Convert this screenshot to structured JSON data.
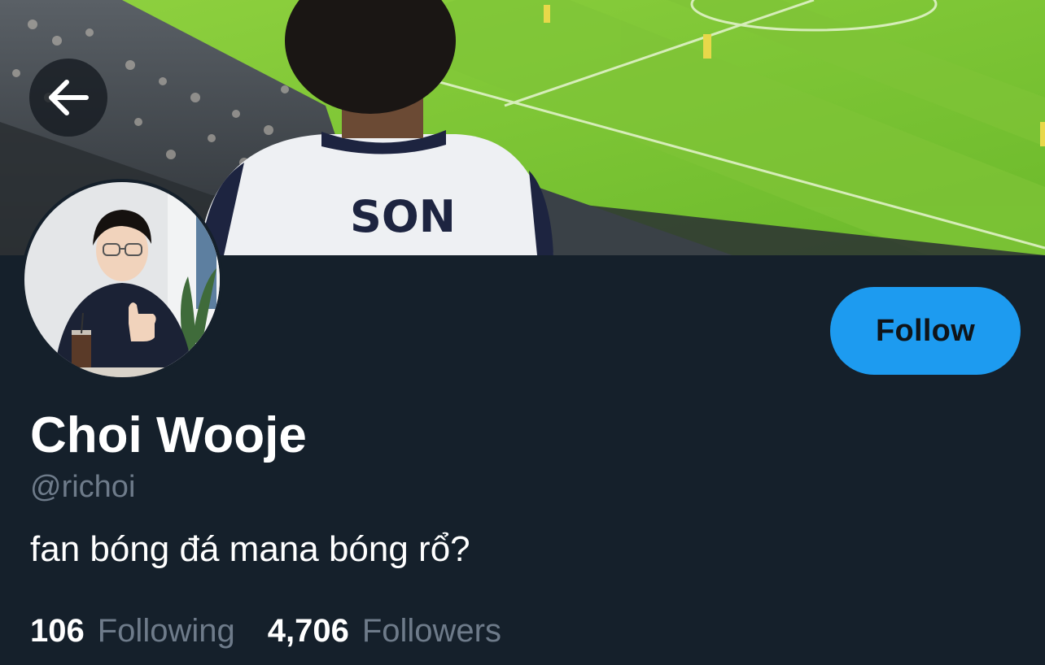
{
  "profile": {
    "display_name": "Choi Wooje",
    "handle": "@richoi",
    "bio": "fan bóng đá mana bóng rổ?",
    "following_count": "106",
    "following_label": "Following",
    "followers_count": "4,706",
    "followers_label": "Followers"
  },
  "actions": {
    "follow_label": "Follow",
    "back_icon": "arrow-left-icon"
  },
  "banner": {
    "jersey_text": "SON"
  },
  "colors": {
    "background": "#15202b",
    "accent": "#1d9bf0",
    "muted_text": "#6e7b8a",
    "primary_text": "#ffffff"
  }
}
